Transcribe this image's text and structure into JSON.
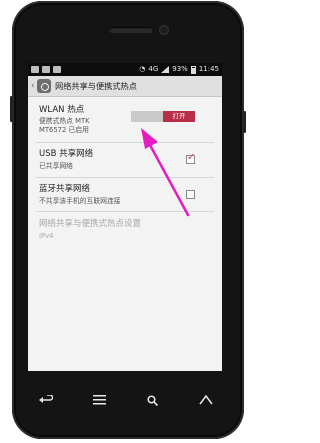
{
  "statusbar": {
    "network": "4G",
    "battery": "93%",
    "time": "11:45"
  },
  "actionbar": {
    "title": "网络共享与便携式热点",
    "app_icon": "settings-icon"
  },
  "items": [
    {
      "title": "WLAN 热点",
      "summary_line1": "便携式热点 MTK",
      "summary_line2": "MT6572 已启用",
      "switch_label": "打开"
    },
    {
      "title": "USB 共享网络",
      "summary": "已共享网络",
      "checked": true
    },
    {
      "title": "蓝牙共享网络",
      "summary": "不共享该手机的互联网连接",
      "checked": false
    },
    {
      "title": "网络共享与便携式热点设置",
      "summary": "IPv4",
      "disabled": true
    }
  ],
  "navbar": [
    "back-icon",
    "menu-icon",
    "search-icon",
    "home-icon"
  ],
  "colors": {
    "accent": "#b62e48",
    "annotation_arrow": "#e51cc2",
    "disabled_text": "#a8a8a8"
  }
}
